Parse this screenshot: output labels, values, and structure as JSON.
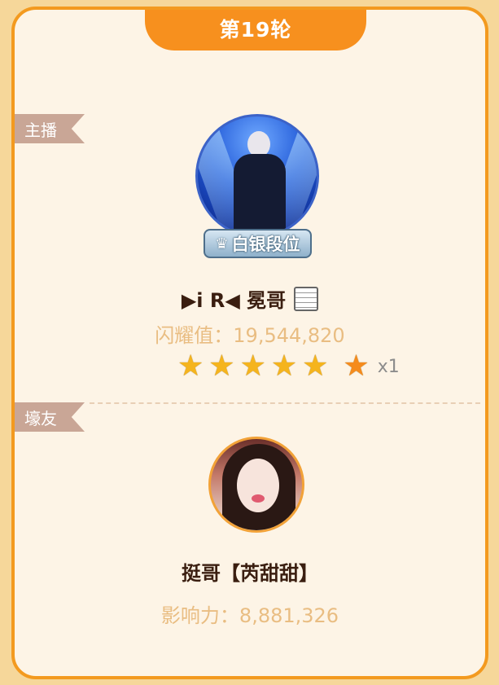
{
  "round": {
    "label": "第19轮"
  },
  "host": {
    "section_label": "主播",
    "rank_icon": "crown-icon",
    "rank_label": "白银段位",
    "name": "▶i R◀ 冕哥",
    "name_icon": "document-icon",
    "metric_label": "闪耀值：",
    "metric_value": "19,544,820",
    "stars": {
      "gold_count": 5,
      "bonus_multiplier": "x1"
    }
  },
  "fan": {
    "section_label": "壕友",
    "name": "挺哥【芮甜甜】",
    "metric_label": "影响力：",
    "metric_value": "8,881,326"
  },
  "colors": {
    "accent": "#f7901e",
    "card_bg": "#fdf4e6",
    "outer_bg": "#f6d79a",
    "star_gold": "#f5b41d",
    "star_orange": "#f58b1d",
    "metric_text": "#e9bd82"
  }
}
